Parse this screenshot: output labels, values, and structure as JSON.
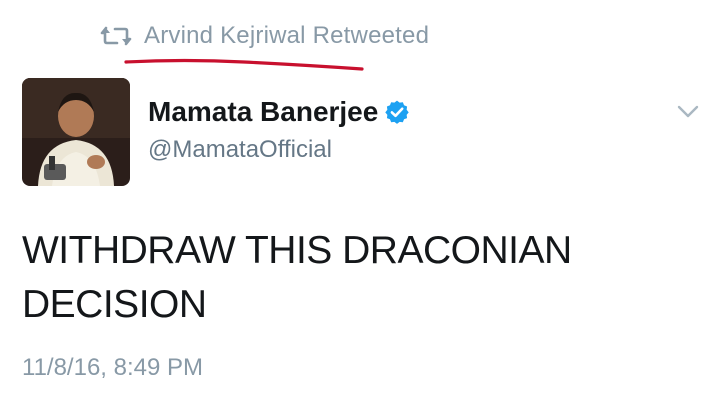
{
  "retweet": {
    "icon": "retweet-icon",
    "user": "Arvind Kejriwal",
    "label": "Arvind Kejriwal Retweeted"
  },
  "annotation": {
    "underline_color": "#c8102e"
  },
  "author": {
    "name": "Mamata Banerjee",
    "handle": "@MamataOfficial",
    "verified": true,
    "verified_icon": "verified-badge-icon",
    "verified_color": "#1da1f2"
  },
  "menu": {
    "icon": "chevron-down-icon"
  },
  "tweet": {
    "text": "WITHDRAW THIS DRACONIAN DECISION",
    "timestamp": "11/8/16, 8:49 PM"
  },
  "colors": {
    "text_primary": "#14171a",
    "text_secondary": "#8899a6",
    "background": "#ffffff"
  }
}
